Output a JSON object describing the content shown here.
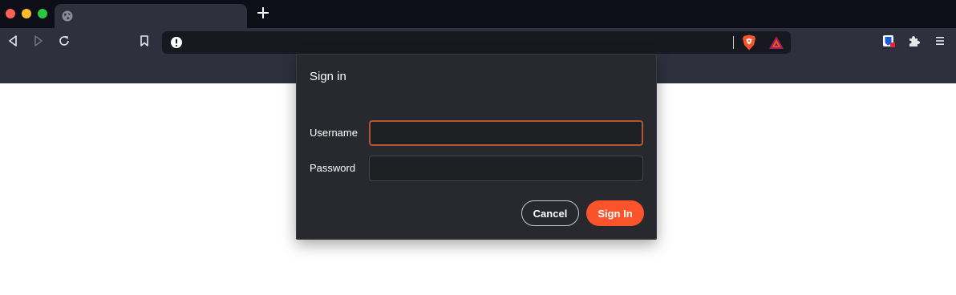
{
  "tabstrip": {
    "new_tab_icon": "plus-icon",
    "tab_icon": "globe-icon"
  },
  "toolbar": {
    "back_icon": "back-arrow-icon",
    "forward_icon": "forward-arrow-icon",
    "reload_icon": "reload-icon",
    "bookmark_icon": "bookmark-icon",
    "url": "",
    "shields_icon": "brave-shields-icon",
    "rewards_icon": "brave-rewards-icon",
    "extension_icon": "bitwarden-icon",
    "extensions_icon": "puzzle-icon",
    "menu_icon": "hamburger-menu-icon"
  },
  "dialog": {
    "title": "Sign in",
    "username_label": "Username",
    "username_value": "",
    "password_label": "Password",
    "password_value": "",
    "cancel_label": "Cancel",
    "signin_label": "Sign In"
  },
  "colors": {
    "accent": "#fb542b",
    "dialog_bg": "#28292e",
    "toolbar_bg": "#2e303e",
    "tabstrip_bg": "#0d0e17"
  }
}
